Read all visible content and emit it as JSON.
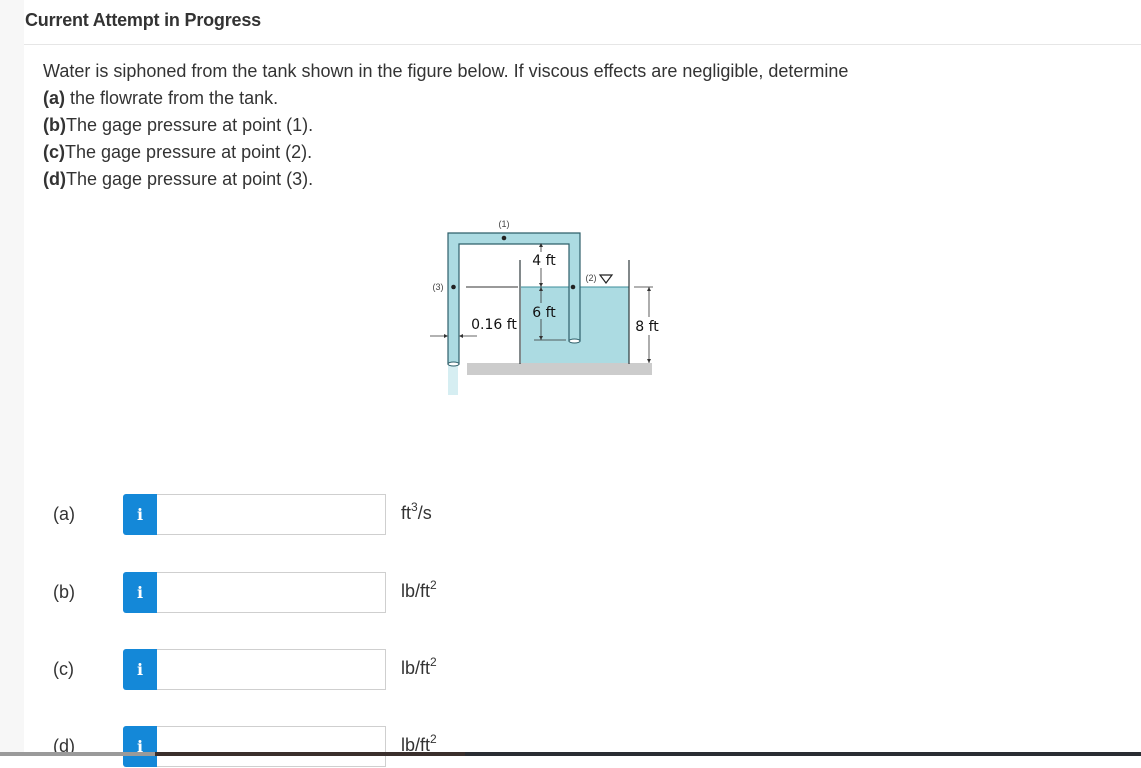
{
  "header": {
    "title": "Current Attempt in Progress"
  },
  "question": {
    "intro": "Water is siphoned from the tank shown in the figure below. If viscous effects are negligible, determine",
    "parts": [
      {
        "tag": "(a)",
        "text": " the flowrate from the tank."
      },
      {
        "tag": "(b)",
        "text": "The gage pressure at point (1)."
      },
      {
        "tag": "(c)",
        "text": "The gage pressure at point (2)."
      },
      {
        "tag": "(d)",
        "text": "The gage pressure at point (3)."
      }
    ]
  },
  "figure": {
    "point_labels": {
      "p1": "(1)",
      "p2": "(2)",
      "p3": "(3)"
    },
    "dimensions": {
      "pipe_above_surface": "4 ft",
      "pipe_below_surface": "6 ft",
      "pipe_diameter": "0.16 ft",
      "water_depth": "8 ft"
    },
    "colors": {
      "water": "#acdbe2",
      "pipe_outline": "#2e5f6a",
      "ground": "#cccccc"
    }
  },
  "answers": [
    {
      "label": "(a)",
      "value": "",
      "unit_base": "ft",
      "unit_sup": "3",
      "unit_tail": "/s",
      "info_icon": "i"
    },
    {
      "label": "(b)",
      "value": "",
      "unit_base": "lb/ft",
      "unit_sup": "2",
      "unit_tail": "",
      "info_icon": "i"
    },
    {
      "label": "(c)",
      "value": "",
      "unit_base": "lb/ft",
      "unit_sup": "2",
      "unit_tail": "",
      "info_icon": "i"
    },
    {
      "label": "(d)",
      "value": "",
      "unit_base": "lb/ft",
      "unit_sup": "2",
      "unit_tail": "",
      "info_icon": "i"
    }
  ],
  "colors": {
    "accent": "#1488d8"
  }
}
